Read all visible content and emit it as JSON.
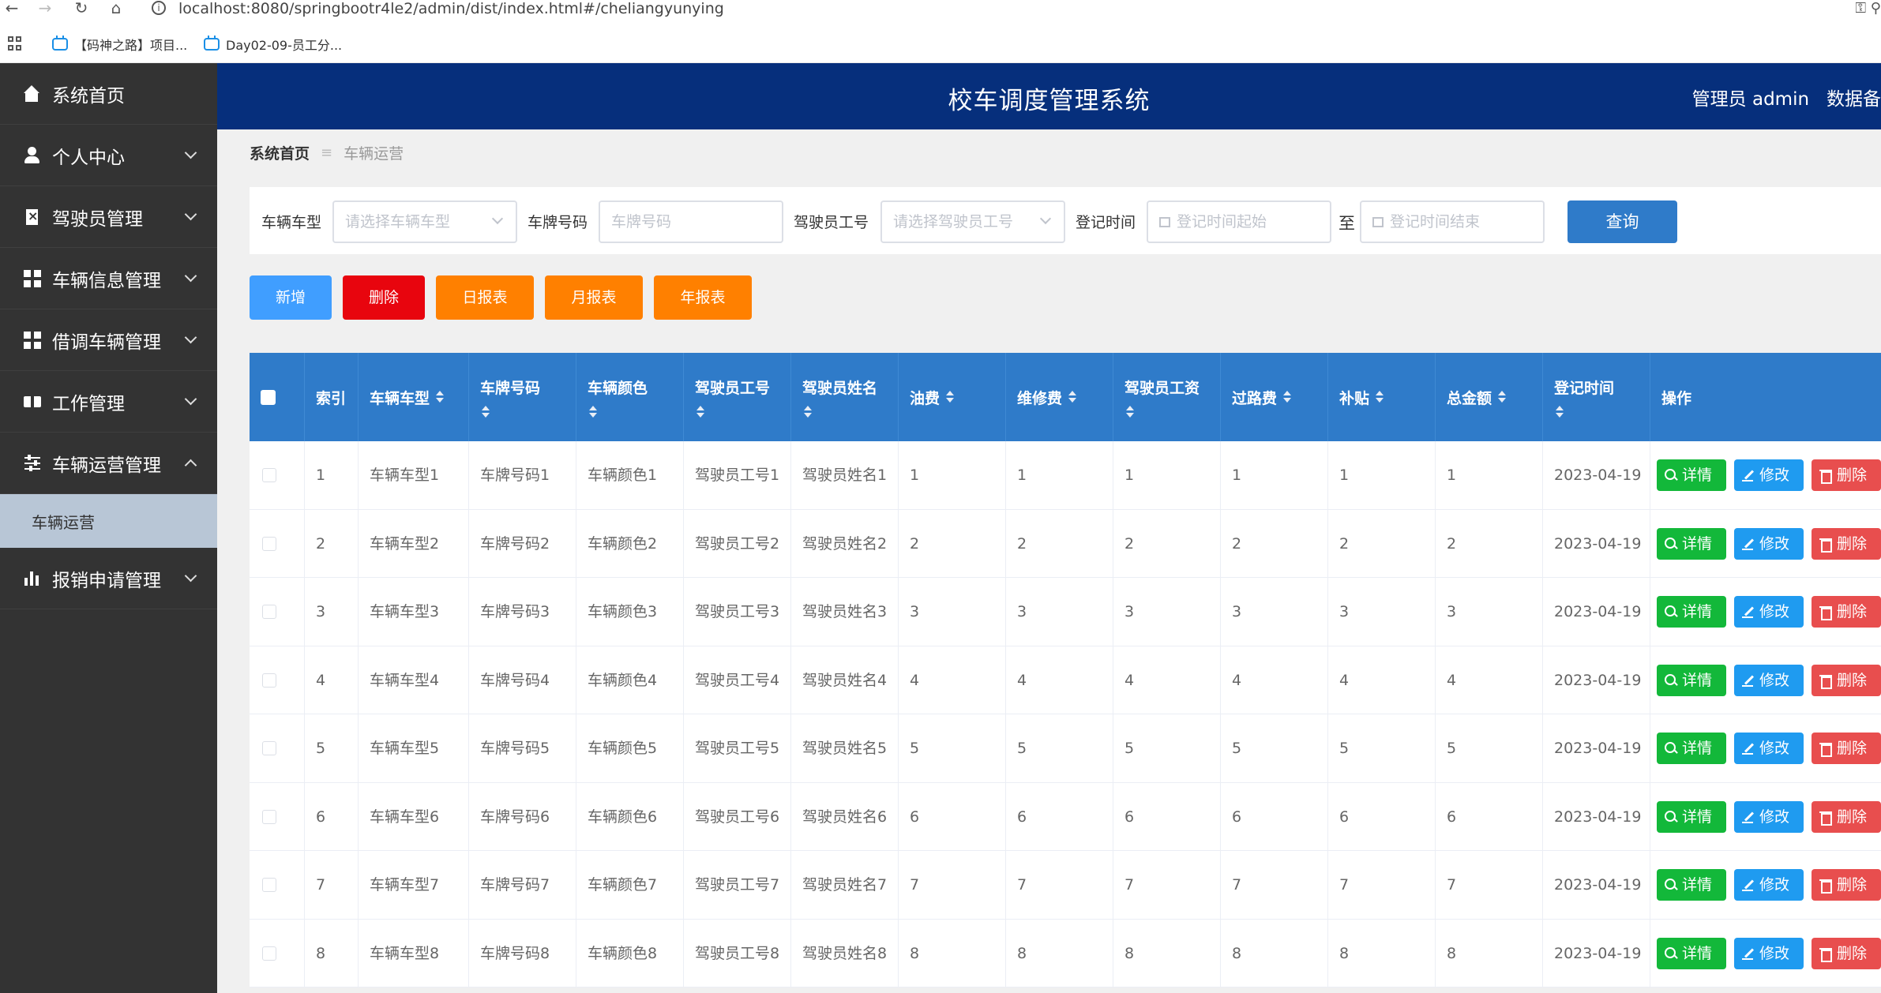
{
  "browser": {
    "url": "localhost:8080/springbootr4le2/admin/dist/index.html#/cheliangyunying",
    "bookmarks": [
      "【码神之路】项目...",
      "Day02-09-员工分..."
    ]
  },
  "header": {
    "title": "校车调度管理系统",
    "user": "管理员 admin",
    "extra": "数据备"
  },
  "sidebar": {
    "items": [
      {
        "label": "系统首页",
        "icon": "home-icon"
      },
      {
        "label": "个人中心",
        "icon": "user-icon"
      },
      {
        "label": "驾驶员管理",
        "icon": "document-icon"
      },
      {
        "label": "车辆信息管理",
        "icon": "grid-icon"
      },
      {
        "label": "借调车辆管理",
        "icon": "grid-icon"
      },
      {
        "label": "工作管理",
        "icon": "ticket-icon"
      },
      {
        "label": "车辆运营管理",
        "icon": "sliders-icon"
      },
      {
        "label": "报销申请管理",
        "icon": "bar-chart-icon"
      }
    ],
    "sub_item": "车辆运营"
  },
  "breadcrumb": {
    "home": "系统首页",
    "separator": "≡",
    "current": "车辆运营"
  },
  "search": {
    "car_type_label": "车辆车型",
    "car_type_placeholder": "请选择车辆车型",
    "plate_label": "车牌号码",
    "plate_placeholder": "车牌号码",
    "driver_id_label": "驾驶员工号",
    "driver_id_placeholder": "请选择驾驶员工号",
    "time_label": "登记时间",
    "time_start_placeholder": "登记时间起始",
    "to_label": "至",
    "time_end_placeholder": "登记时间结束",
    "query_label": "查询"
  },
  "actions": {
    "add": "新增",
    "delete": "删除",
    "daily": "日报表",
    "monthly": "月报表",
    "yearly": "年报表",
    "colors": {
      "add": "#409eff",
      "delete": "#e8050e",
      "report": "#ff8000"
    }
  },
  "table": {
    "headers": [
      "索引",
      "车辆车型",
      "车牌号码",
      "车辆颜色",
      "驾驶员工号",
      "驾驶员姓名",
      "油费",
      "维修费",
      "驾驶员工资",
      "过路费",
      "补贴",
      "总金额",
      "登记时间",
      "操作"
    ],
    "rows": [
      [
        "1",
        "车辆车型1",
        "车牌号码1",
        "车辆颜色1",
        "驾驶员工号1",
        "驾驶员姓名1",
        "1",
        "1",
        "1",
        "1",
        "1",
        "1",
        "2023-04-19"
      ],
      [
        "2",
        "车辆车型2",
        "车牌号码2",
        "车辆颜色2",
        "驾驶员工号2",
        "驾驶员姓名2",
        "2",
        "2",
        "2",
        "2",
        "2",
        "2",
        "2023-04-19"
      ],
      [
        "3",
        "车辆车型3",
        "车牌号码3",
        "车辆颜色3",
        "驾驶员工号3",
        "驾驶员姓名3",
        "3",
        "3",
        "3",
        "3",
        "3",
        "3",
        "2023-04-19"
      ],
      [
        "4",
        "车辆车型4",
        "车牌号码4",
        "车辆颜色4",
        "驾驶员工号4",
        "驾驶员姓名4",
        "4",
        "4",
        "4",
        "4",
        "4",
        "4",
        "2023-04-19"
      ],
      [
        "5",
        "车辆车型5",
        "车牌号码5",
        "车辆颜色5",
        "驾驶员工号5",
        "驾驶员姓名5",
        "5",
        "5",
        "5",
        "5",
        "5",
        "5",
        "2023-04-19"
      ],
      [
        "6",
        "车辆车型6",
        "车牌号码6",
        "车辆颜色6",
        "驾驶员工号6",
        "驾驶员姓名6",
        "6",
        "6",
        "6",
        "6",
        "6",
        "6",
        "2023-04-19"
      ],
      [
        "7",
        "车辆车型7",
        "车牌号码7",
        "车辆颜色7",
        "驾驶员工号7",
        "驾驶员姓名7",
        "7",
        "7",
        "7",
        "7",
        "7",
        "7",
        "2023-04-19"
      ],
      [
        "8",
        "车辆车型8",
        "车牌号码8",
        "车辆颜色8",
        "驾驶员工号8",
        "驾驶员姓名8",
        "8",
        "8",
        "8",
        "8",
        "8",
        "8",
        "2023-04-19"
      ]
    ],
    "op_labels": {
      "detail": "详情",
      "edit": "修改",
      "delete": "删除"
    }
  },
  "theme": {
    "header_bg": "#062f7c",
    "sidebar_bg": "#333333",
    "table_header_bg": "#2f7bc9",
    "active_sub_bg": "#b8c6d6"
  }
}
